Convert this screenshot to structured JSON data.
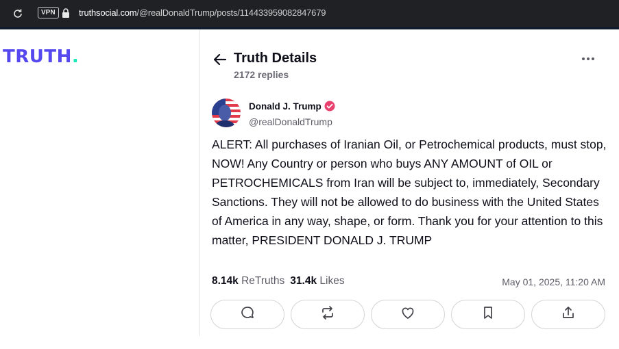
{
  "browser": {
    "url_domain": "truthsocial.com",
    "url_path": "/@realDonaldTrump/posts/114433959082847679",
    "vpn_label": "VPN"
  },
  "brand": {
    "logo_text": "TRUTH",
    "logo_dot": "."
  },
  "header": {
    "title": "Truth Details",
    "replies": "2172 replies"
  },
  "post": {
    "author_name": "Donald J. Trump",
    "author_handle": "@realDonaldTrump",
    "text": "ALERT: All purchases of Iranian Oil, or Petrochemical products, must stop, NOW! Any Country or person who buys ANY AMOUNT of OIL or PETROCHEMICALS from Iran will be subject to, immediately, Secondary Sanctions. They will not be allowed to do business with the United States of America in any way, shape, or form. Thank you for your attention to this matter, PRESIDENT DONALD J. TRUMP",
    "retruths_count": "8.14k",
    "retruths_label": "ReTruths",
    "likes_count": "31.4k",
    "likes_label": "Likes",
    "timestamp": "May 01, 2025, 11:20 AM"
  },
  "actions": [
    "reply-icon",
    "retruth-icon",
    "like-icon",
    "bookmark-icon",
    "share-icon"
  ],
  "colors": {
    "brand": "#5448ee",
    "brand_accent": "#17e8b6",
    "verified": "#e9406d"
  }
}
